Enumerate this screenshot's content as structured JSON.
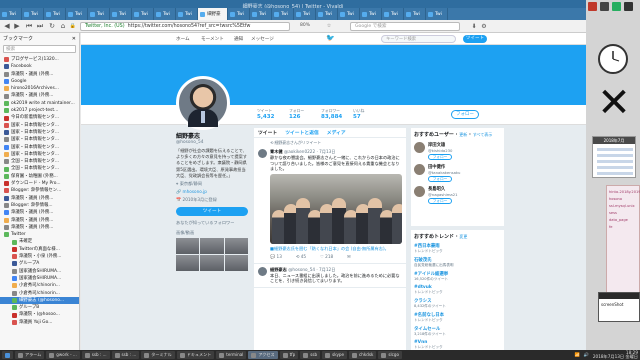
{
  "window": {
    "title": "細野豪志 (@hosono_54) | Twitter - Vivaldi"
  },
  "tabs": [
    {
      "label": "Twi"
    },
    {
      "label": "Twi"
    },
    {
      "label": "Twi"
    },
    {
      "label": "Twi"
    },
    {
      "label": "Twi"
    },
    {
      "label": "Twi"
    },
    {
      "label": "Twi"
    },
    {
      "label": "Twi"
    },
    {
      "label": "Twi"
    },
    {
      "label": "細野豪"
    },
    {
      "label": "Twi"
    },
    {
      "label": "Twi"
    },
    {
      "label": "Twi"
    },
    {
      "label": "Twi"
    },
    {
      "label": "Twi"
    },
    {
      "label": "Twi"
    },
    {
      "label": "Twi"
    },
    {
      "label": "Twi"
    },
    {
      "label": "Twi"
    },
    {
      "label": "Twi"
    }
  ],
  "nav": {
    "url_org": "Twitter, Inc. (US)",
    "url": "https://twitter.com/hosono54?ref_src=twsrc%5Etfw",
    "zoom": "80%",
    "search_placeholder": "Google で検索"
  },
  "sidebar": {
    "title": "ブックマーク",
    "search_placeholder": "検索",
    "items": [
      {
        "label": "ブログサービス(1320..."
      },
      {
        "label": "Facebook"
      },
      {
        "label": "衆議院・議員 (外務..."
      },
      {
        "label": "Google"
      },
      {
        "label": "hirono2016Archives..."
      },
      {
        "label": "衆議院・議員 (外務..."
      },
      {
        "label": "ok2019 write at maintainer..."
      },
      {
        "label": "ok2017 project-test..."
      },
      {
        "label": "今日の新着情報センタ..."
      },
      {
        "label": "国家・日本情報センタ..."
      },
      {
        "label": "国家・日本情報センタ..."
      },
      {
        "label": "国家・日本情報センタ..."
      },
      {
        "label": "国家・日本情報センタ..."
      },
      {
        "label": "国家・日本情報センタ..."
      },
      {
        "label": "全国・日本情報センタ..."
      },
      {
        "label": "全国・日本情報センタ..."
      },
      {
        "label": "保育園・幼稚園 (外務..."
      },
      {
        "label": "ダウンロード - My Pro..."
      },
      {
        "label": "Blogger: 衆参情報セン..."
      },
      {
        "label": "衆議院・議員 (外務..."
      },
      {
        "label": "Blogger: 衆参情報..."
      },
      {
        "label": "衆議院・議員 (外務..."
      },
      {
        "label": "衆議院・議員 (外務..."
      },
      {
        "label": "衆議院・議員 (外務..."
      },
      {
        "label": "Twitter"
      },
      {
        "label": "未確定"
      },
      {
        "label": "Twitterの真面な様..."
      },
      {
        "label": "衆議院・小泉 (外務..."
      },
      {
        "label": "グループA"
      },
      {
        "label": "国家議会SHIRUMA..."
      },
      {
        "label": "国家議会SHIRUMA..."
      },
      {
        "label": "小倉秀司/chinorin..."
      },
      {
        "label": "小倉秀司/chinorin..."
      },
      {
        "label": "細野豪志 (@hosono..."
      },
      {
        "label": "グループB"
      },
      {
        "label": "衆議院・(@hosoo..."
      },
      {
        "label": "衆議員 Yoji Go..."
      }
    ],
    "selected_index": 33
  },
  "twitter_nav": {
    "home": "ホーム",
    "moments": "モーメント",
    "notifications": "通知",
    "messages": "メッセージ",
    "search_placeholder": "キーワード検索",
    "tweet_button": "ツイート"
  },
  "profile": {
    "stats": [
      {
        "label": "ツイート",
        "value": "5,432"
      },
      {
        "label": "フォロー",
        "value": "126"
      },
      {
        "label": "フォロワー",
        "value": "83,884"
      },
      {
        "label": "いいね",
        "value": "57"
      }
    ],
    "follow_button": "フォロー",
    "name": "細野豪志",
    "handle": "@hosono_54",
    "bio": "「細野が社会の課題を伝えることで、より多くの方々の意見を持って提案することをめざします。衆議院・静岡県第5区選出。環境大臣、原発事故担当大臣、党政調会長等を歴任。」",
    "location": "東京都/静岡",
    "website": "mhosono.jp",
    "joined": "2010年3月に登録",
    "tweet_to_button": "ツイート",
    "followers_you_know": "あなたが知っているフォロワー",
    "photos_label": "画像/動画"
  },
  "timeline": {
    "tabs": [
      "ツイート",
      "ツイートと返信",
      "メディア"
    ],
    "retweet_label": "細野豪志さんがリツイート",
    "tweets": [
      {
        "name": "青木健",
        "handle": "@aokiken0222 · 7月13日",
        "text": "静かな夜の懇談会。細野豪志さんと一緒に、これからの日本の政治について語り合いました。皆様のご意見を直接伺える貴重な機会となりました。",
        "caption": "■細野豪志氏を囲む「熱くなれ日本」の会 (自由·無所属有志)。"
      },
      {
        "name": "細野豪志",
        "handle": "@hosono_54 · 7月12日",
        "text": "本日、ニュース番組に出演しました。政治を前に進めるために必要なことを、引き続き発信してまいります。"
      }
    ],
    "actions": {
      "reply": "13",
      "retweet": "45",
      "like": "218"
    }
  },
  "recommend": {
    "title": "おすすめユーザー",
    "refresh": "更新",
    "show_all": "すべて表示",
    "users": [
      {
        "name": "岸田文雄",
        "handle": "@kishida230"
      },
      {
        "name": "田中健作",
        "handle": "@tanakakensaku"
      },
      {
        "name": "長島昭久",
        "handle": "@nagashima21"
      }
    ],
    "follow": "フォロー"
  },
  "trends": {
    "title": "おすすめトレンド",
    "change": "変更",
    "items": [
      {
        "tag": "#西日本豪雨",
        "sub": "トレンドトピック"
      },
      {
        "tag": "石破茂氏",
        "sub": "自民党総裁選に出馬表明"
      },
      {
        "tag": "#アイドル総選挙",
        "sub": "16,520件のツイート"
      },
      {
        "tag": "#dtvuk",
        "sub": "トレンドトピック"
      },
      {
        "tag": "クラシス",
        "sub": "8,432件のツイート"
      },
      {
        "tag": "#名前なし日本",
        "sub": "トレンドトピック"
      },
      {
        "tag": "タイムセール",
        "sub": "3,218件のツイート"
      },
      {
        "tag": "#Vnn",
        "sub": "トレンドトピック"
      },
      {
        "tag": "今日のアイドルコラボ",
        "sub": "トレンドトピック"
      }
    ]
  },
  "desktop": {
    "calendar_title": "2018年7月",
    "pink_lines": [
      "hinto-2018y.2019y",
      "hosono",
      "ssl-mysql.unix",
      "sess",
      "data_page",
      "fe"
    ],
    "shot_window_title": "screenShot"
  },
  "taskbar": {
    "items": [
      {
        "label": "アラーム"
      },
      {
        "label": "gwork - ..."
      },
      {
        "label": "ssb : ..."
      },
      {
        "label": "ssb : ..."
      },
      {
        "label": "ターミナル"
      },
      {
        "label": "ドキュメント"
      },
      {
        "label": "terminal"
      },
      {
        "label": "アクセス"
      },
      {
        "label": "tfp"
      },
      {
        "label": "ssb"
      },
      {
        "label": "skype"
      },
      {
        "label": "chkdsk"
      },
      {
        "label": "slcgo"
      }
    ],
    "clock_time": "18:29",
    "clock_date": "2018年7月13日 金曜日"
  },
  "colors": {
    "twitter_blue": "#1da1f2",
    "title_bar": "#2f6d9f",
    "selected": "#3a84d4"
  }
}
